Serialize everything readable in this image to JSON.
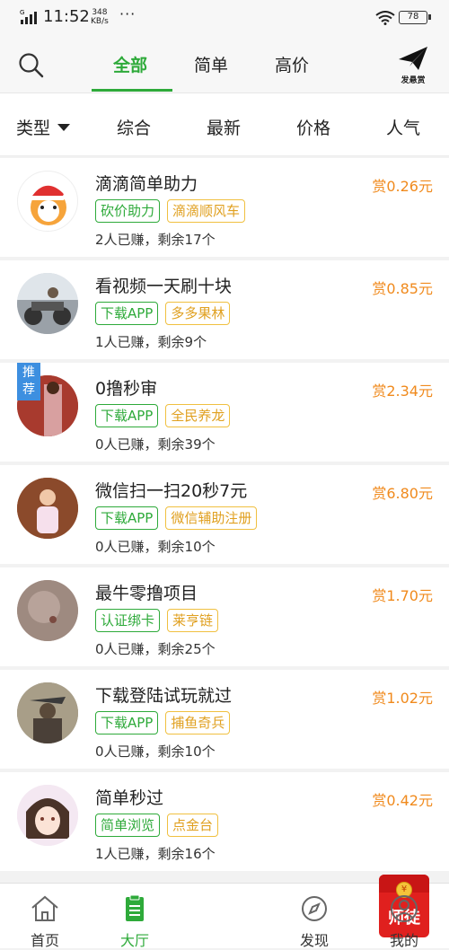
{
  "status_bar": {
    "time": "11:52",
    "net_speed": "348",
    "net_unit": "KB/s",
    "battery": "78",
    "carrier_mark": "G"
  },
  "top_tabs": [
    {
      "label": "全部",
      "active": true
    },
    {
      "label": "简单"
    },
    {
      "label": "高价"
    }
  ],
  "publish_label": "发悬赏",
  "filters": {
    "type": "类型",
    "items": [
      "综合",
      "最新",
      "价格",
      "人气"
    ]
  },
  "recommend_badge": "推荐",
  "tasks": [
    {
      "title": "滴滴简单助力",
      "price": "赏0.26元",
      "tags": [
        {
          "text": "砍价助力",
          "color": "green"
        },
        {
          "text": "滴滴顺风车",
          "color": "orange"
        }
      ],
      "meta": "2人已赚，剩余17个"
    },
    {
      "title": "看视频一天刷十块",
      "price": "赏0.85元",
      "tags": [
        {
          "text": "下载APP",
          "color": "green"
        },
        {
          "text": "多多果林",
          "color": "orange"
        }
      ],
      "meta": "1人已赚，剩余9个"
    },
    {
      "title": "0撸秒审",
      "price": "赏2.34元",
      "tags": [
        {
          "text": "下载APP",
          "color": "green"
        },
        {
          "text": "全民养龙",
          "color": "orange"
        }
      ],
      "meta": "0人已赚，剩余39个"
    },
    {
      "title": "微信扫一扫20秒7元",
      "price": "赏6.80元",
      "tags": [
        {
          "text": "下载APP",
          "color": "green"
        },
        {
          "text": "微信辅助注册",
          "color": "orange"
        }
      ],
      "meta": "0人已赚，剩余10个"
    },
    {
      "title": "最牛零撸项目",
      "price": "赏1.70元",
      "tags": [
        {
          "text": "认证绑卡",
          "color": "green"
        },
        {
          "text": "莱亨链",
          "color": "orange"
        }
      ],
      "meta": "0人已赚，剩余25个"
    },
    {
      "title": "下载登陆试玩就过",
      "price": "赏1.02元",
      "tags": [
        {
          "text": "下载APP",
          "color": "green"
        },
        {
          "text": "捕鱼奇兵",
          "color": "orange"
        }
      ],
      "meta": "0人已赚，剩余10个"
    },
    {
      "title": "简单秒过",
      "price": "赏0.42元",
      "tags": [
        {
          "text": "简单浏览",
          "color": "green"
        },
        {
          "text": "点金台",
          "color": "orange"
        }
      ],
      "meta": "1人已赚，剩余16个"
    }
  ],
  "bottom_nav": [
    {
      "label": "首页"
    },
    {
      "label": "大厅",
      "active": true
    },
    {
      "label": "师徒",
      "special": true
    },
    {
      "label": "发现"
    },
    {
      "label": "我的"
    }
  ],
  "colors": {
    "accent": "#2eaa3a",
    "price": "#f08a1d",
    "tag_orange": "#e0a020",
    "badge_blue": "#3d8fe0",
    "red_packet": "#e0201e"
  }
}
